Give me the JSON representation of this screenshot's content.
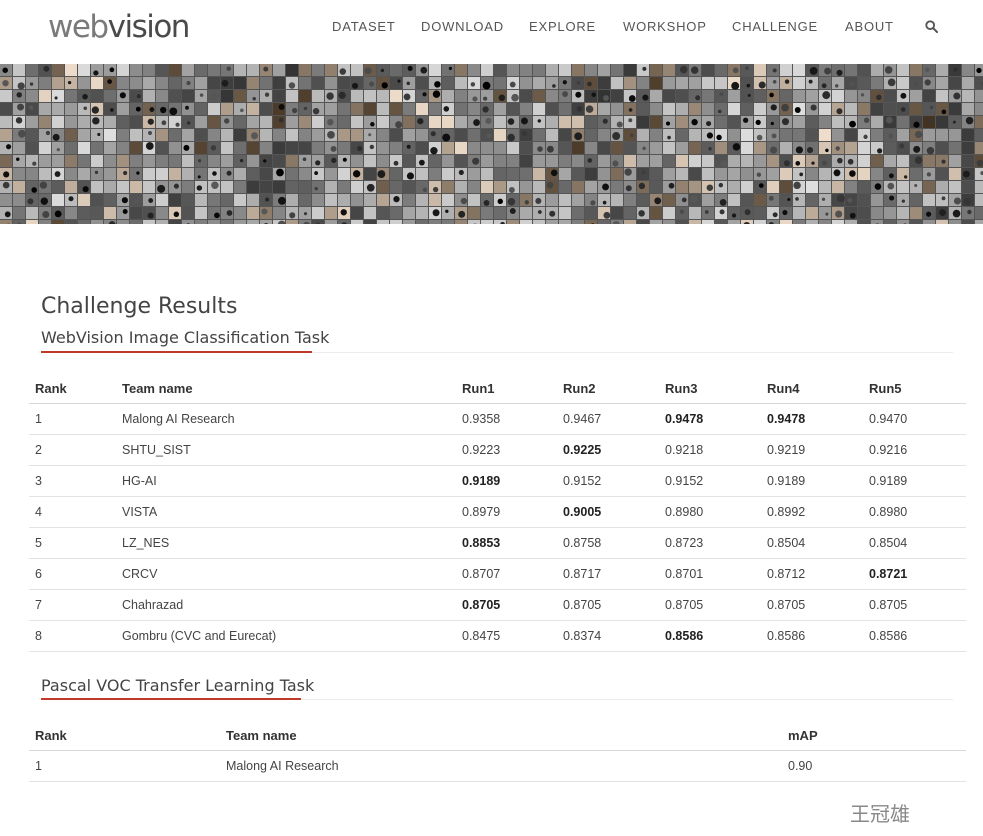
{
  "header": {
    "logo_part1": "web",
    "logo_part2": "vision",
    "nav": [
      "DATASET",
      "DOWNLOAD",
      "EXPLORE",
      "WORKSHOP",
      "CHALLENGE",
      "ABOUT"
    ],
    "search_icon": "search-icon"
  },
  "page_title": "Challenge Results",
  "classification": {
    "title": "WebVision Image Classification Task",
    "columns": [
      "Rank",
      "Team name",
      "Run1",
      "Run2",
      "Run3",
      "Run4",
      "Run5"
    ],
    "rows": [
      {
        "rank": "1",
        "team": "Malong AI Research",
        "runs": [
          "0.9358",
          "0.9467",
          "0.9478",
          "0.9478",
          "0.9470"
        ],
        "best": [
          2,
          3
        ]
      },
      {
        "rank": "2",
        "team": "SHTU_SIST",
        "runs": [
          "0.9223",
          "0.9225",
          "0.9218",
          "0.9219",
          "0.9216"
        ],
        "best": [
          1
        ]
      },
      {
        "rank": "3",
        "team": "HG-AI",
        "runs": [
          "0.9189",
          "0.9152",
          "0.9152",
          "0.9189",
          "0.9189"
        ],
        "best": [
          0
        ]
      },
      {
        "rank": "4",
        "team": "VISTA",
        "runs": [
          "0.8979",
          "0.9005",
          "0.8980",
          "0.8992",
          "0.8980"
        ],
        "best": [
          1
        ]
      },
      {
        "rank": "5",
        "team": "LZ_NES",
        "runs": [
          "0.8853",
          "0.8758",
          "0.8723",
          "0.8504",
          "0.8504"
        ],
        "best": [
          0
        ]
      },
      {
        "rank": "6",
        "team": "CRCV",
        "runs": [
          "0.8707",
          "0.8717",
          "0.8701",
          "0.8712",
          "0.8721"
        ],
        "best": [
          4
        ]
      },
      {
        "rank": "7",
        "team": "Chahrazad",
        "runs": [
          "0.8705",
          "0.8705",
          "0.8705",
          "0.8705",
          "0.8705"
        ],
        "best": [
          0
        ]
      },
      {
        "rank": "8",
        "team": "Gombru (CVC and Eurecat)",
        "runs": [
          "0.8475",
          "0.8374",
          "0.8586",
          "0.8586",
          "0.8586"
        ],
        "best": [
          2
        ]
      }
    ]
  },
  "transfer": {
    "title": "Pascal VOC Transfer Learning Task",
    "columns": [
      "Rank",
      "Team name",
      "mAP"
    ],
    "rows": [
      {
        "rank": "1",
        "team": "Malong AI Research",
        "map": "0.90"
      }
    ]
  },
  "watermark": "王冠雄",
  "colors": {
    "accent_rule": "#c0392b",
    "text": "#333333",
    "nav": "#555555"
  }
}
